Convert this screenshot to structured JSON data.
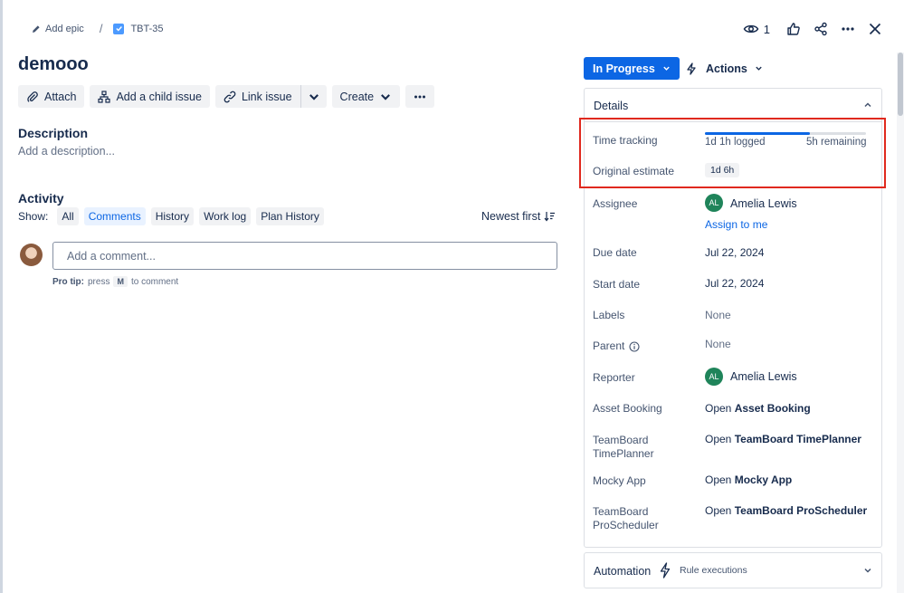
{
  "breadcrumb": {
    "epic": "Add epic",
    "separator": "/",
    "issue_key": "TBT-35"
  },
  "header": {
    "watch_count": "1"
  },
  "issue": {
    "title": "demooo"
  },
  "toolbar": {
    "attach": "Attach",
    "child": "Add a child issue",
    "link": "Link issue",
    "create": "Create"
  },
  "description": {
    "heading": "Description",
    "placeholder": "Add a description..."
  },
  "activity": {
    "heading": "Activity",
    "show_label": "Show:",
    "filters": [
      "All",
      "Comments",
      "History",
      "Work log",
      "Plan History"
    ],
    "selected": "Comments",
    "sort": "Newest first",
    "comment_placeholder": "Add a comment...",
    "protip_bold": "Pro tip:",
    "protip_press": "press",
    "protip_key": "M",
    "protip_rest": "to comment"
  },
  "status": {
    "label": "In Progress",
    "actions": "Actions"
  },
  "details": {
    "heading": "Details",
    "time_tracking": {
      "label": "Time tracking",
      "logged": "1d 1h logged",
      "remaining": "5h remaining",
      "progress": 0.65
    },
    "original_estimate": {
      "label": "Original estimate",
      "value": "1d 6h"
    },
    "assignee": {
      "label": "Assignee",
      "initials": "AL",
      "name": "Amelia Lewis",
      "assign_me": "Assign to me"
    },
    "due_date": {
      "label": "Due date",
      "value": "Jul 22, 2024"
    },
    "start_date": {
      "label": "Start date",
      "value": "Jul 22, 2024"
    },
    "labels": {
      "label": "Labels",
      "value": "None"
    },
    "parent": {
      "label": "Parent",
      "value": "None"
    },
    "reporter": {
      "label": "Reporter",
      "initials": "AL",
      "name": "Amelia Lewis"
    },
    "asset_booking": {
      "label": "Asset Booking",
      "open": "Open",
      "app": "Asset Booking"
    },
    "timeplanner": {
      "label_1": "TeamBoard",
      "label_2": "TimePlanner",
      "open": "Open",
      "app": "TeamBoard TimePlanner"
    },
    "mocky": {
      "label": "Mocky App",
      "open": "Open",
      "app": "Mocky App"
    },
    "proscheduler": {
      "label_1": "TeamBoard",
      "label_2": "ProScheduler",
      "open": "Open",
      "app": "TeamBoard ProScheduler"
    }
  },
  "automation": {
    "label": "Automation",
    "sub": "Rule executions"
  },
  "colors": {
    "primary": "#0c66e4",
    "highlight": "#e0291e",
    "avatar": "#1f845a"
  }
}
